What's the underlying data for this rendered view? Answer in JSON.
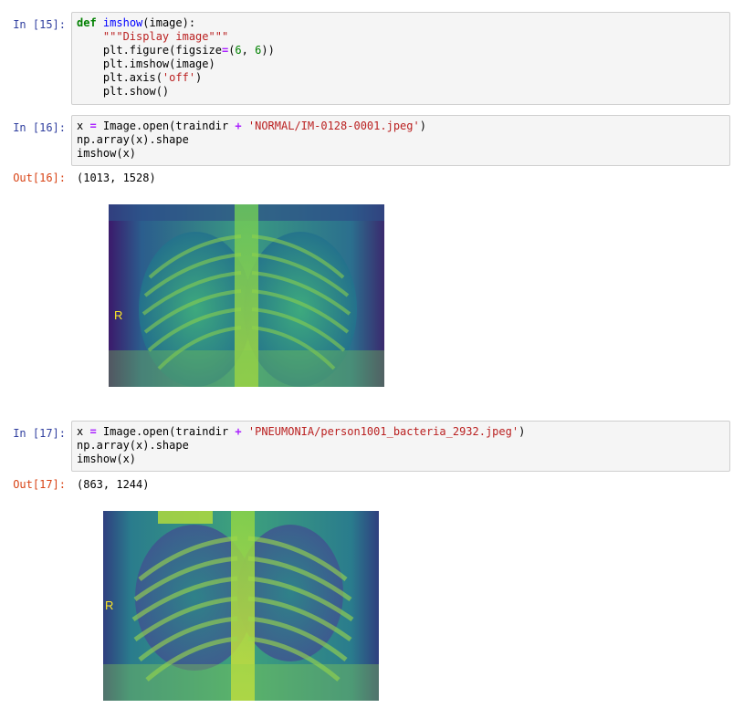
{
  "cells": [
    {
      "prompt": "In [15]:",
      "code": [
        [
          {
            "t": "def",
            "c": "kw"
          },
          {
            "t": " "
          },
          {
            "t": "imshow",
            "c": "fn"
          },
          {
            "t": "(image):"
          }
        ],
        [
          {
            "t": "    "
          },
          {
            "t": "\"\"\"Display image\"\"\"",
            "c": "doc"
          }
        ],
        [
          {
            "t": "    plt.figure(figsize"
          },
          {
            "t": "=",
            "c": "op"
          },
          {
            "t": "("
          },
          {
            "t": "6",
            "c": "num"
          },
          {
            "t": ", "
          },
          {
            "t": "6",
            "c": "num"
          },
          {
            "t": "))"
          }
        ],
        [
          {
            "t": "    plt.imshow(image)"
          }
        ],
        [
          {
            "t": "    plt.axis("
          },
          {
            "t": "'off'",
            "c": "str"
          },
          {
            "t": ")"
          }
        ],
        [
          {
            "t": "    plt.show()"
          }
        ]
      ]
    },
    {
      "prompt": "In [16]:",
      "code": [
        [
          {
            "t": "x "
          },
          {
            "t": "=",
            "c": "op"
          },
          {
            "t": " Image.open(traindir "
          },
          {
            "t": "+",
            "c": "op"
          },
          {
            "t": " "
          },
          {
            "t": "'NORMAL/IM-0128-0001.jpeg'",
            "c": "str"
          },
          {
            "t": ")"
          }
        ],
        [
          {
            "t": "np.array(x).shape"
          }
        ],
        [
          {
            "t": "imshow(x)"
          }
        ]
      ],
      "out_prompt": "Out[16]:",
      "out_text": "(1013, 1528)",
      "figure_label": "R"
    },
    {
      "prompt": "In [17]:",
      "code": [
        [
          {
            "t": "x "
          },
          {
            "t": "=",
            "c": "op"
          },
          {
            "t": " Image.open(traindir "
          },
          {
            "t": "+",
            "c": "op"
          },
          {
            "t": " "
          },
          {
            "t": "'PNEUMONIA/person1001_bacteria_2932.jpeg'",
            "c": "str"
          },
          {
            "t": ")"
          }
        ],
        [
          {
            "t": "np.array(x).shape"
          }
        ],
        [
          {
            "t": "imshow(x)"
          }
        ]
      ],
      "out_prompt": "Out[17]:",
      "out_text": "(863, 1244)",
      "figure_label": "R"
    }
  ],
  "colors": {
    "in_prompt": "#303f9f",
    "out_prompt": "#d84315",
    "viridis_dark": "#440154",
    "viridis_mid": "#21918c",
    "viridis_light": "#fde725"
  }
}
